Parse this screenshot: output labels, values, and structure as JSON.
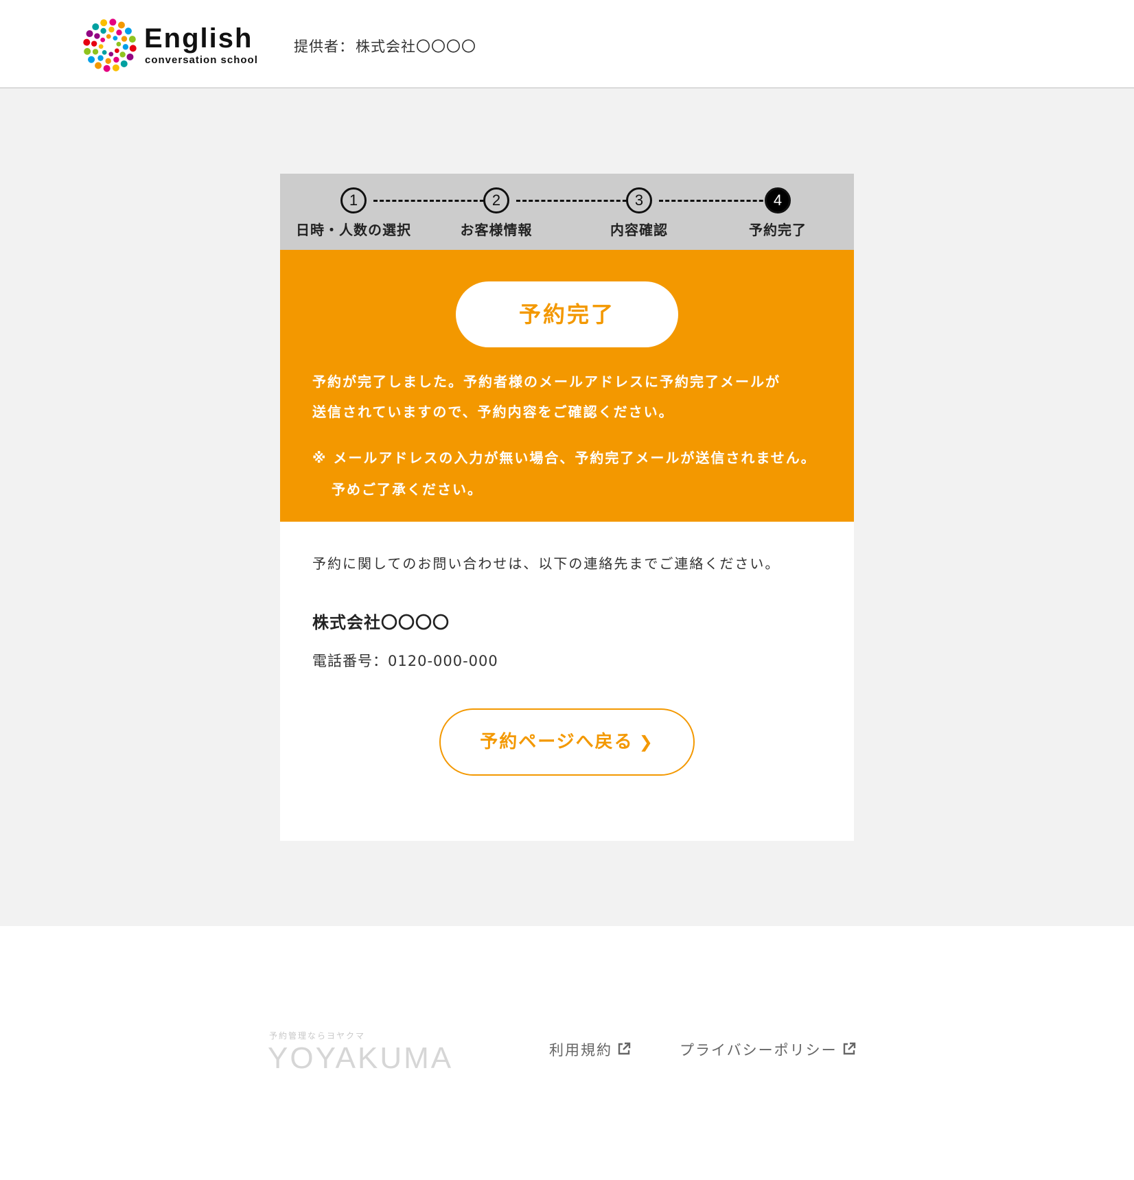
{
  "header": {
    "logo_title": "English",
    "logo_subtitle": "conversation school",
    "provider_label": "提供者：",
    "provider_name": "株式会社〇〇〇〇"
  },
  "steps": [
    {
      "number": "1",
      "label": "日時・人数の選択",
      "active": false
    },
    {
      "number": "2",
      "label": "お客様情報",
      "active": false
    },
    {
      "number": "3",
      "label": "内容確認",
      "active": false
    },
    {
      "number": "4",
      "label": "予約完了",
      "active": true
    }
  ],
  "completion": {
    "badge": "予約完了",
    "message_line1": "予約が完了しました。予約者様のメールアドレスに予約完了メールが",
    "message_line2": "送信されていますので、予約内容をご確認ください。",
    "note": "※ メールアドレスの入力が無い場合、予約完了メールが送信されません。予めご了承ください。"
  },
  "contact": {
    "intro": "予約に関してのお問い合わせは、以下の連絡先までご連絡ください。",
    "company": "株式会社〇〇〇〇",
    "phone": "電話番号：0120-000-000"
  },
  "back_button": {
    "label": "予約ページへ戻る",
    "icon": "chevron-right-icon"
  },
  "footer": {
    "brand_tagline": "予約管理ならヨヤクマ",
    "brand_name": "YOYAKUMA",
    "links": [
      {
        "label": "利用規約",
        "icon": "external-link-icon"
      },
      {
        "label": "プライバシーポリシー",
        "icon": "external-link-icon"
      }
    ]
  },
  "colors": {
    "accent": "#f39800",
    "page_bg": "#f2f2f2",
    "steps_bg": "#cccccc"
  }
}
